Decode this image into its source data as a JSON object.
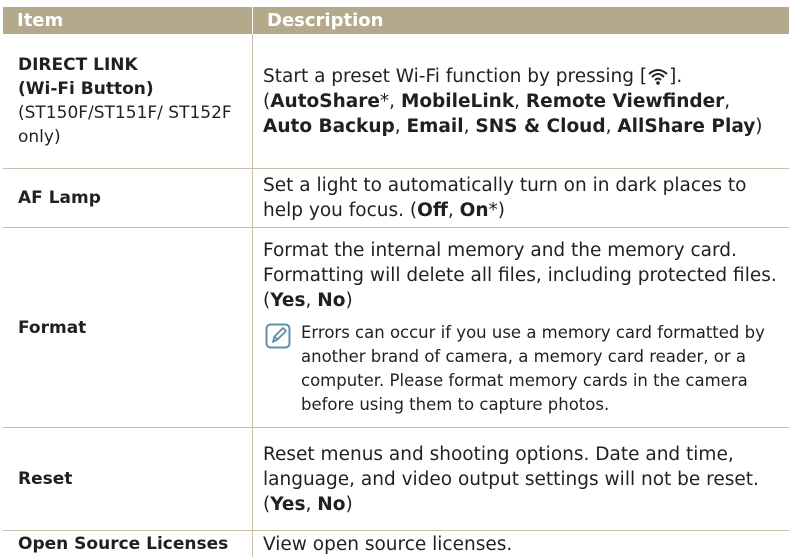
{
  "header": {
    "col_item": "Item",
    "col_desc": "Description"
  },
  "colors": {
    "header_bg": "#b5a98b",
    "border": "#c8c0ad",
    "text": "#231f20"
  },
  "rows": [
    {
      "item": "DIRECT LINK",
      "item_sub": "(Wi-Fi Button)",
      "item_note": "(ST150F/ST151F/ ST152F only)",
      "desc_line1_pre": "Start a preset Wi-Fi function by pressing [",
      "desc_line1_icon": "wifi-icon",
      "desc_line1_post": "].",
      "opt_open": "(",
      "opts": [
        "AutoShare",
        "MobileLink",
        "Remote Viewfinder",
        "Auto Backup",
        "Email",
        "SNS & Cloud",
        "AllShare Play"
      ],
      "opt_close": ")",
      "default_mark": "*",
      "sep": ", "
    },
    {
      "item": "AF Lamp",
      "desc": "Set a light to automatically turn on in dark places to help you focus.",
      "opt_open": "(",
      "opts": [
        "Off",
        "On"
      ],
      "opt_close": ")",
      "default_mark": "*",
      "sep": ", "
    },
    {
      "item": "Format",
      "desc": "Format the internal memory and the memory card. Formatting will delete all files, including protected files.",
      "opt_open": "(",
      "opts": [
        "Yes",
        "No"
      ],
      "opt_close": ")",
      "sep": ", ",
      "note_icon": "note-pencil-icon",
      "note": "Errors can occur if you use a memory card formatted by another brand of camera, a memory card reader, or a computer. Please format memory cards in the camera before using them to capture photos."
    },
    {
      "item": "Reset",
      "desc": "Reset menus and shooting options. Date and time, language, and video output settings will not be reset.",
      "opt_open": "(",
      "opts": [
        "Yes",
        "No"
      ],
      "opt_close": ")",
      "sep": ", "
    },
    {
      "item": "Open Source Licenses",
      "desc": "View open source licenses."
    }
  ]
}
